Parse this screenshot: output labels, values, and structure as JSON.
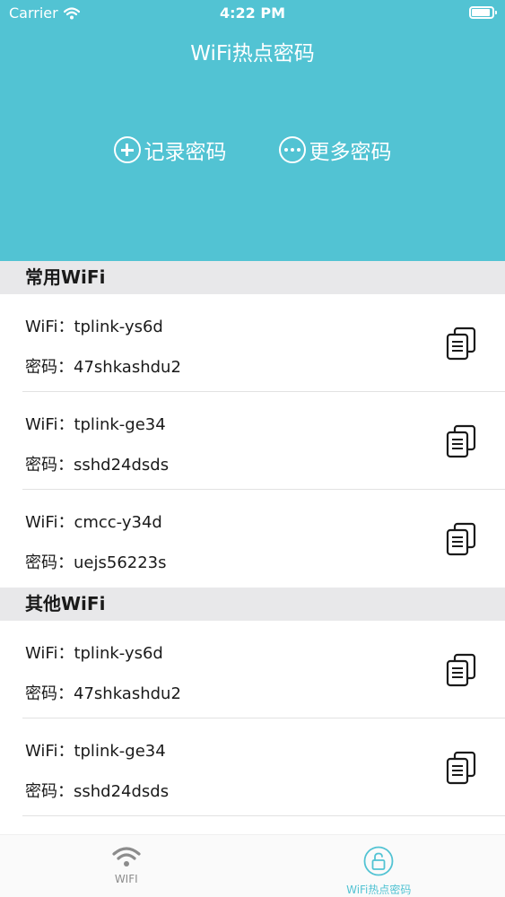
{
  "status_bar": {
    "carrier": "Carrier",
    "time": "4:22 PM"
  },
  "header": {
    "title": "WiFi热点密码"
  },
  "actions": [
    {
      "label": "记录密码",
      "icon": "plus-circle-icon"
    },
    {
      "label": "更多密码",
      "icon": "more-circle-icon"
    }
  ],
  "sections": [
    {
      "title": "常用WiFi",
      "items": [
        {
          "ssid_prefix": "WiFi：",
          "ssid": "tplink-ys6d",
          "pwd_prefix": "密码：",
          "password": "47shkashdu2"
        },
        {
          "ssid_prefix": "WiFi：",
          "ssid": "tplink-ge34",
          "pwd_prefix": "密码：",
          "password": "sshd24dsds"
        },
        {
          "ssid_prefix": "WiFi：",
          "ssid": "cmcc-y34d",
          "pwd_prefix": "密码：",
          "password": "uejs56223s"
        }
      ]
    },
    {
      "title": "其他WiFi",
      "items": [
        {
          "ssid_prefix": "WiFi：",
          "ssid": "tplink-ys6d",
          "pwd_prefix": "密码：",
          "password": "47shkashdu2"
        },
        {
          "ssid_prefix": "WiFi：",
          "ssid": "tplink-ge34",
          "pwd_prefix": "密码：",
          "password": "sshd24dsds"
        }
      ]
    }
  ],
  "tabbar": {
    "tabs": [
      {
        "label": "WIFI",
        "icon": "wifi-icon",
        "active": false
      },
      {
        "label": "WiFi热点密码",
        "icon": "unlock-icon",
        "active": true
      }
    ]
  },
  "colors": {
    "accent": "#52c3d3",
    "section_bg": "#e8e8ea",
    "tab_inactive": "#8c8c8c"
  }
}
